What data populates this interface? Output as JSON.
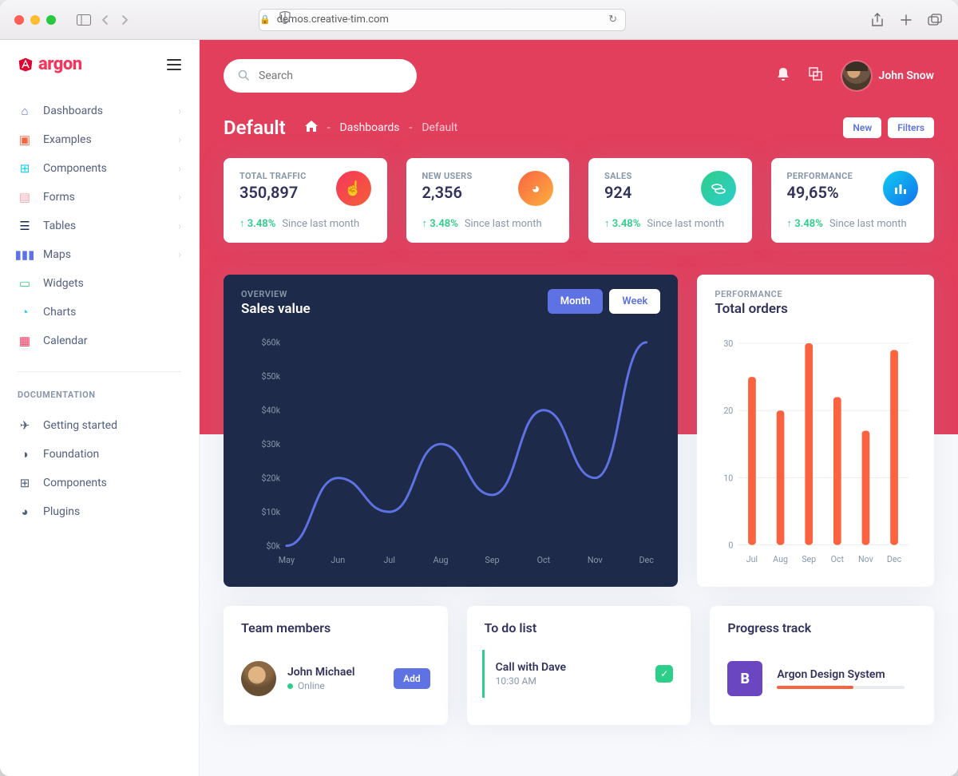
{
  "browser": {
    "url": "demos.creative-tim.com"
  },
  "brand": {
    "name": "argon"
  },
  "search": {
    "placeholder": "Search"
  },
  "user": {
    "name": "John Snow"
  },
  "sidebar": {
    "items": [
      {
        "label": "Dashboards",
        "expandable": true
      },
      {
        "label": "Examples",
        "expandable": true
      },
      {
        "label": "Components",
        "expandable": true
      },
      {
        "label": "Forms",
        "expandable": true
      },
      {
        "label": "Tables",
        "expandable": true
      },
      {
        "label": "Maps",
        "expandable": true
      },
      {
        "label": "Widgets",
        "expandable": false
      },
      {
        "label": "Charts",
        "expandable": false
      },
      {
        "label": "Calendar",
        "expandable": false
      }
    ],
    "docs_heading": "DOCUMENTATION",
    "docs": [
      {
        "label": "Getting started"
      },
      {
        "label": "Foundation"
      },
      {
        "label": "Components"
      },
      {
        "label": "Plugins"
      }
    ]
  },
  "header": {
    "title": "Default",
    "crumb1": "Dashboards",
    "crumb2": "Default",
    "actions": {
      "new": "New",
      "filters": "Filters"
    }
  },
  "stats": [
    {
      "label": "TOTAL TRAFFIC",
      "value": "350,897",
      "delta": "3.48%",
      "since": "Since last month"
    },
    {
      "label": "NEW USERS",
      "value": "2,356",
      "delta": "3.48%",
      "since": "Since last month"
    },
    {
      "label": "SALES",
      "value": "924",
      "delta": "3.48%",
      "since": "Since last month"
    },
    {
      "label": "PERFORMANCE",
      "value": "49,65%",
      "delta": "3.48%",
      "since": "Since last month"
    }
  ],
  "sales_chart": {
    "overline": "OVERVIEW",
    "title": "Sales value",
    "tabs": {
      "month": "Month",
      "week": "Week"
    }
  },
  "orders_chart": {
    "overline": "PERFORMANCE",
    "title": "Total orders"
  },
  "team": {
    "title": "Team members",
    "members": [
      {
        "name": "John Michael",
        "status": "Online",
        "add": "Add"
      }
    ]
  },
  "todo": {
    "title": "To do list",
    "items": [
      {
        "title": "Call with Dave",
        "time": "10:30 AM",
        "done": true
      }
    ]
  },
  "progress": {
    "title": "Progress track",
    "items": [
      {
        "name": "Argon Design System",
        "pct": 60
      }
    ]
  },
  "chart_data": [
    {
      "id": "sales_value",
      "type": "line",
      "x": [
        "May",
        "Jun",
        "Jul",
        "Aug",
        "Sep",
        "Oct",
        "Nov",
        "Dec"
      ],
      "values": [
        0,
        20,
        10,
        30,
        15,
        40,
        20,
        60
      ],
      "y_ticks": [
        0,
        10,
        20,
        30,
        40,
        50,
        60
      ],
      "y_tick_labels": [
        "$0k",
        "$10k",
        "$20k",
        "$30k",
        "$40k",
        "$50k",
        "$60k"
      ],
      "y_unit": "$k",
      "ylim": [
        0,
        60
      ],
      "title": "Sales value"
    },
    {
      "id": "total_orders",
      "type": "bar",
      "categories": [
        "Jul",
        "Aug",
        "Sep",
        "Oct",
        "Nov",
        "Dec"
      ],
      "values": [
        25,
        20,
        30,
        22,
        17,
        29
      ],
      "y_ticks": [
        0,
        10,
        20,
        30
      ],
      "ylim": [
        0,
        30
      ],
      "title": "Total orders"
    }
  ]
}
